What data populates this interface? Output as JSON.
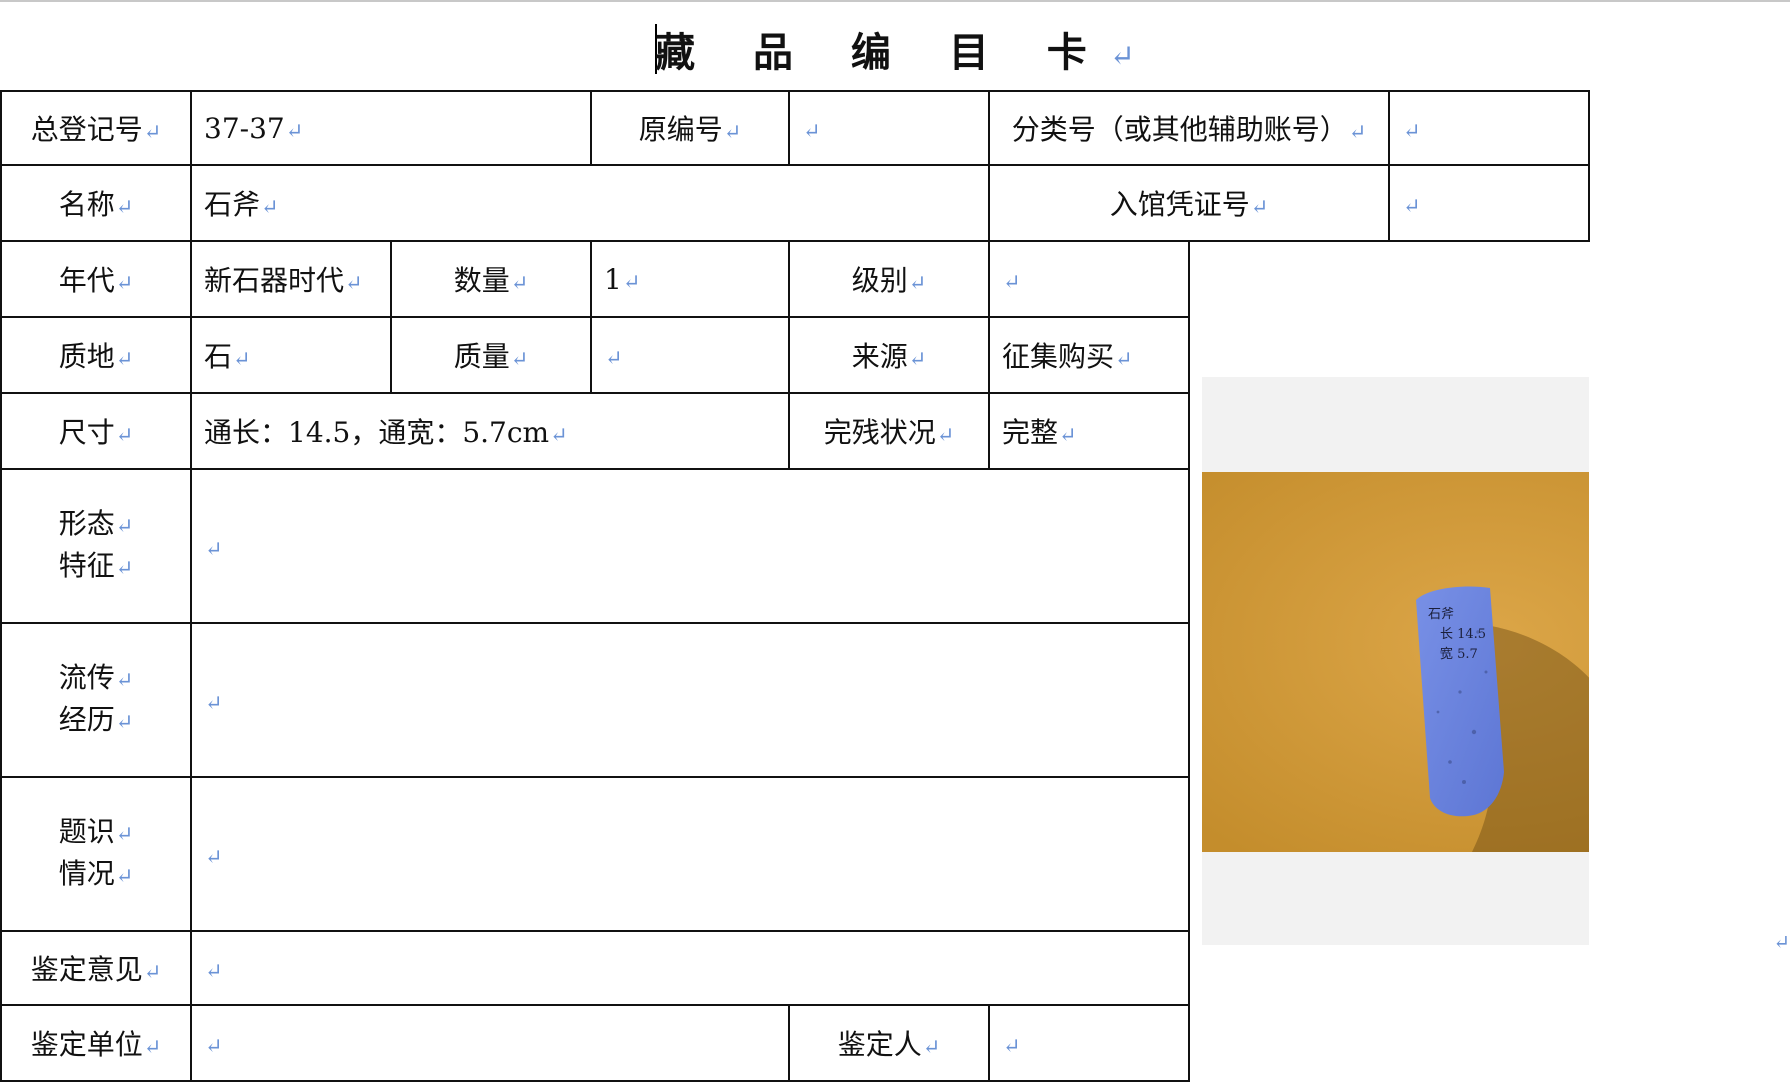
{
  "title": "藏 品 编 目 卡",
  "paragraph_mark": "↵",
  "rows": {
    "reg_no_label": "总登记号",
    "reg_no_value": "37-37",
    "orig_no_label": "原编号",
    "orig_no_value": "",
    "class_no_label": "分类号（或其他辅助账号）",
    "class_no_value": "",
    "name_label": "名称",
    "name_value": "石斧",
    "voucher_label": "入馆凭证号",
    "voucher_value": "",
    "era_label": "年代",
    "era_value": "新石器时代",
    "qty_label": "数量",
    "qty_value": "1",
    "grade_label": "级别",
    "grade_value": "",
    "material_label": "质地",
    "material_value": "石",
    "mass_label": "质量",
    "mass_value": "",
    "source_label": "来源",
    "source_value": "征集购买",
    "size_label": "尺寸",
    "size_value": "通长：14.5，通宽：5.7cm",
    "condition_label": "完残状况",
    "condition_value": "完整",
    "form_label_1": "形态",
    "form_label_2": "特征",
    "form_value": "",
    "history_label_1": "流传",
    "history_label_2": "经历",
    "history_value": "",
    "inscription_label_1": "题识",
    "inscription_label_2": "情况",
    "inscription_value": "",
    "opinion_label": "鉴定意见",
    "opinion_value": "",
    "unit_label": "鉴定单位",
    "unit_value": "",
    "appraiser_label": "鉴定人",
    "appraiser_value": ""
  },
  "photo": {
    "label_line1": "石斧",
    "label_line2": "长 14.5",
    "label_line3": "宽 5.7",
    "colors": {
      "background": "#d19a36",
      "axe": "#6f86e0",
      "shadow": "#6b4a12"
    }
  }
}
